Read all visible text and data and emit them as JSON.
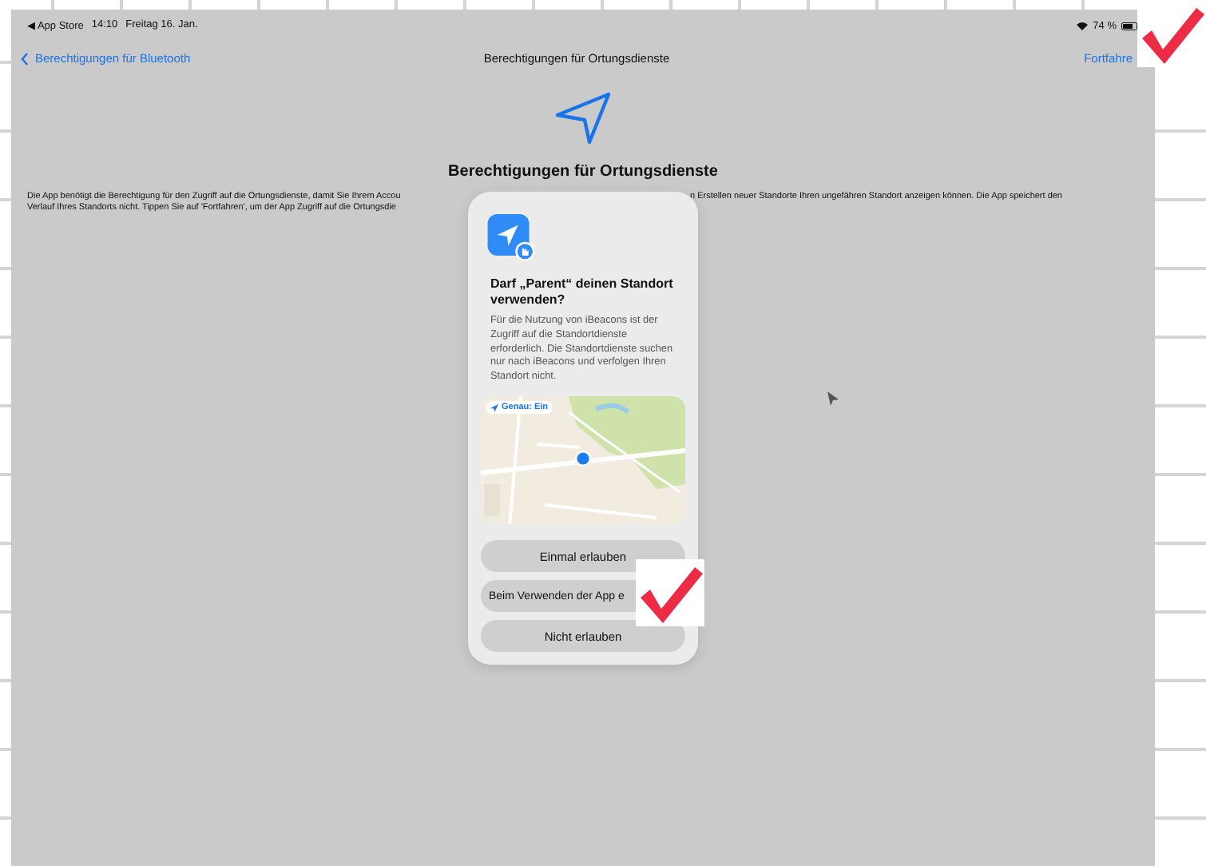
{
  "status_bar": {
    "back_app": "◀ App Store",
    "time": "14:10",
    "date": "Freitag 16. Jan.",
    "battery": "74 %"
  },
  "nav_bar": {
    "back": "Berechtigungen für Bluetooth",
    "title": "Berechtigungen für Ortungsdienste",
    "action": "Fortfahre"
  },
  "heading": "Berechtigungen für Ortungsdienste",
  "description": {
    "line_1_left": "Die App benötigt die Berechtigung für den Zugriff auf die Ortungsdienste, damit Sie Ihrem Accou",
    "line_1_right": "n Erstellen neuer Standorte Ihren ungefähren Standort anzeigen können. Die App speichert den",
    "line_2_left": "Verlauf Ihres Standorts nicht. Tippen Sie auf 'Fortfahren', um der App Zugriff auf die Ortungsdie"
  },
  "dialog": {
    "title": "Darf „Parent“ deinen Standort verwenden?",
    "message": "Für die Nutzung von iBeacons ist der Zugriff auf die Standortdienste erforderlich. Die Standortdienste suchen nur nach iBeacons und verfolgen Ihren Standort nicht.",
    "map": {
      "kind": "picture",
      "precise_chip": "Genau: Ein"
    },
    "buttons": [
      {
        "label": "Einmal erlauben"
      },
      {
        "label": "Beim Verwenden der App e"
      },
      {
        "label": "Nicht erlauben"
      }
    ]
  }
}
